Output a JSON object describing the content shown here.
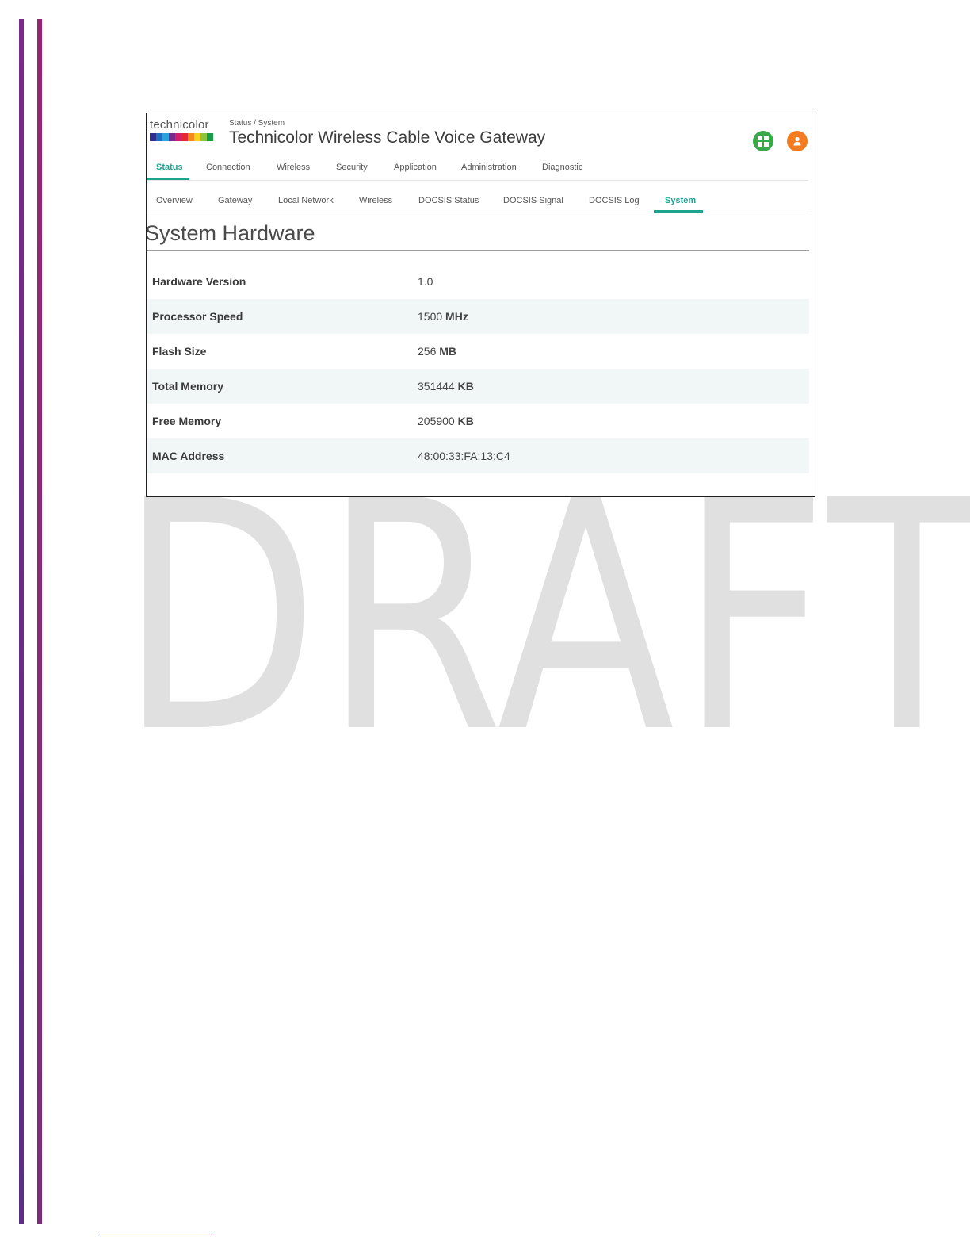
{
  "watermark": {
    "text": "DRAFT"
  },
  "gateway": {
    "logo_text": "technicolor",
    "logo_colors": [
      "#2f2d8f",
      "#1f6fc1",
      "#2ba3dd",
      "#7c2a8f",
      "#d61f69",
      "#e5252f",
      "#f58a1f",
      "#f6d31d",
      "#8cc63f",
      "#1a9b48"
    ],
    "breadcrumb": "Status / System",
    "title": "Technicolor Wireless Cable Voice Gateway",
    "accent_color": "#1fa38f",
    "icons": [
      "grid-icon",
      "user-icon"
    ],
    "tabs": [
      {
        "label": "Status",
        "active": true
      },
      {
        "label": "Connection"
      },
      {
        "label": "Wireless"
      },
      {
        "label": "Security"
      },
      {
        "label": "Application"
      },
      {
        "label": "Administration"
      },
      {
        "label": "Diagnostic"
      }
    ],
    "subtabs": [
      {
        "label": "Overview"
      },
      {
        "label": "Gateway"
      },
      {
        "label": "Local Network"
      },
      {
        "label": "Wireless"
      },
      {
        "label": "DOCSIS Status"
      },
      {
        "label": "DOCSIS Signal"
      },
      {
        "label": "DOCSIS Log"
      },
      {
        "label": "System",
        "active": true
      }
    ],
    "section_title": "System Hardware",
    "hardware": [
      {
        "label": "Hardware Version",
        "value": "1.0",
        "unit": ""
      },
      {
        "label": "Processor Speed",
        "value": "1500",
        "unit": "MHz"
      },
      {
        "label": "Flash Size",
        "value": "256",
        "unit": "MB"
      },
      {
        "label": "Total Memory",
        "value": "351444",
        "unit": "KB"
      },
      {
        "label": "Free Memory",
        "value": "205900",
        "unit": "KB"
      },
      {
        "label": "MAC Address",
        "value": "48:00:33:FA:13:C4",
        "unit": ""
      }
    ]
  }
}
